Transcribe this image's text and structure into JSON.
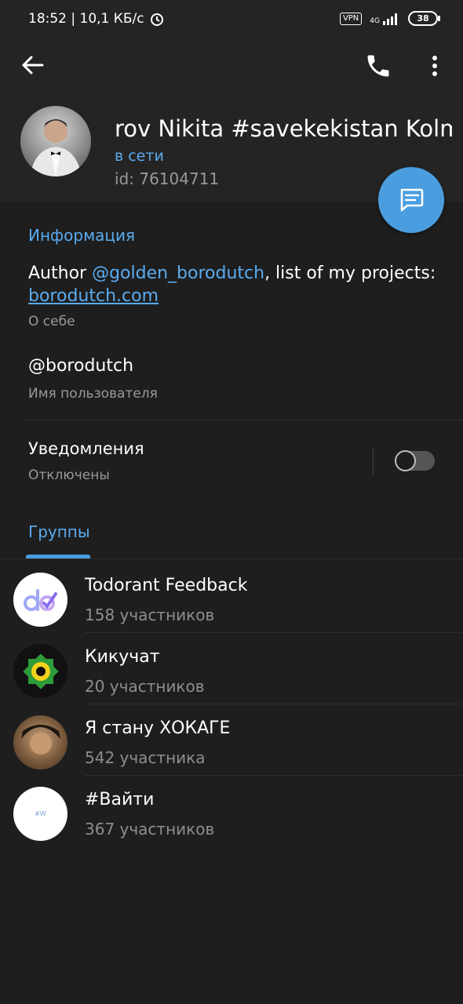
{
  "status_bar": {
    "time_speed": "18:52 | 10,1 КБ/с",
    "alarm_icon": "alarm-clock-icon",
    "vpn": "VPN",
    "network": "4G",
    "battery": "38"
  },
  "profile": {
    "name": "rov   Nikita #savekekistan Kolm",
    "status": "в сети",
    "id_text": "id: 76104711"
  },
  "info": {
    "section_title": "Информация",
    "bio_author": "Author ",
    "bio_mention": "@golden_borodutch",
    "bio_middle": ", list of my projects: ",
    "bio_link": "borodutch.com",
    "bio_caption": "О себе",
    "username": "@borodutch",
    "username_caption": "Имя пользователя",
    "notifications_title": "Уведомления",
    "notifications_status": "Отключены"
  },
  "groups_tab": "Группы",
  "groups": [
    {
      "title": "Todorant Feedback",
      "members": "158 участников"
    },
    {
      "title": "Кикучат",
      "members": "20 участников"
    },
    {
      "title": "Я стану ХОКАГЕ",
      "members": "542 участника"
    },
    {
      "title": "#Вайти",
      "members": "367 участников"
    }
  ],
  "group_avatar_labels": {
    "vayti": "#W"
  },
  "colors": {
    "accent": "#5aacf0",
    "fab": "#4a9ee0",
    "background": "#1e1e1e",
    "header": "#242424"
  }
}
